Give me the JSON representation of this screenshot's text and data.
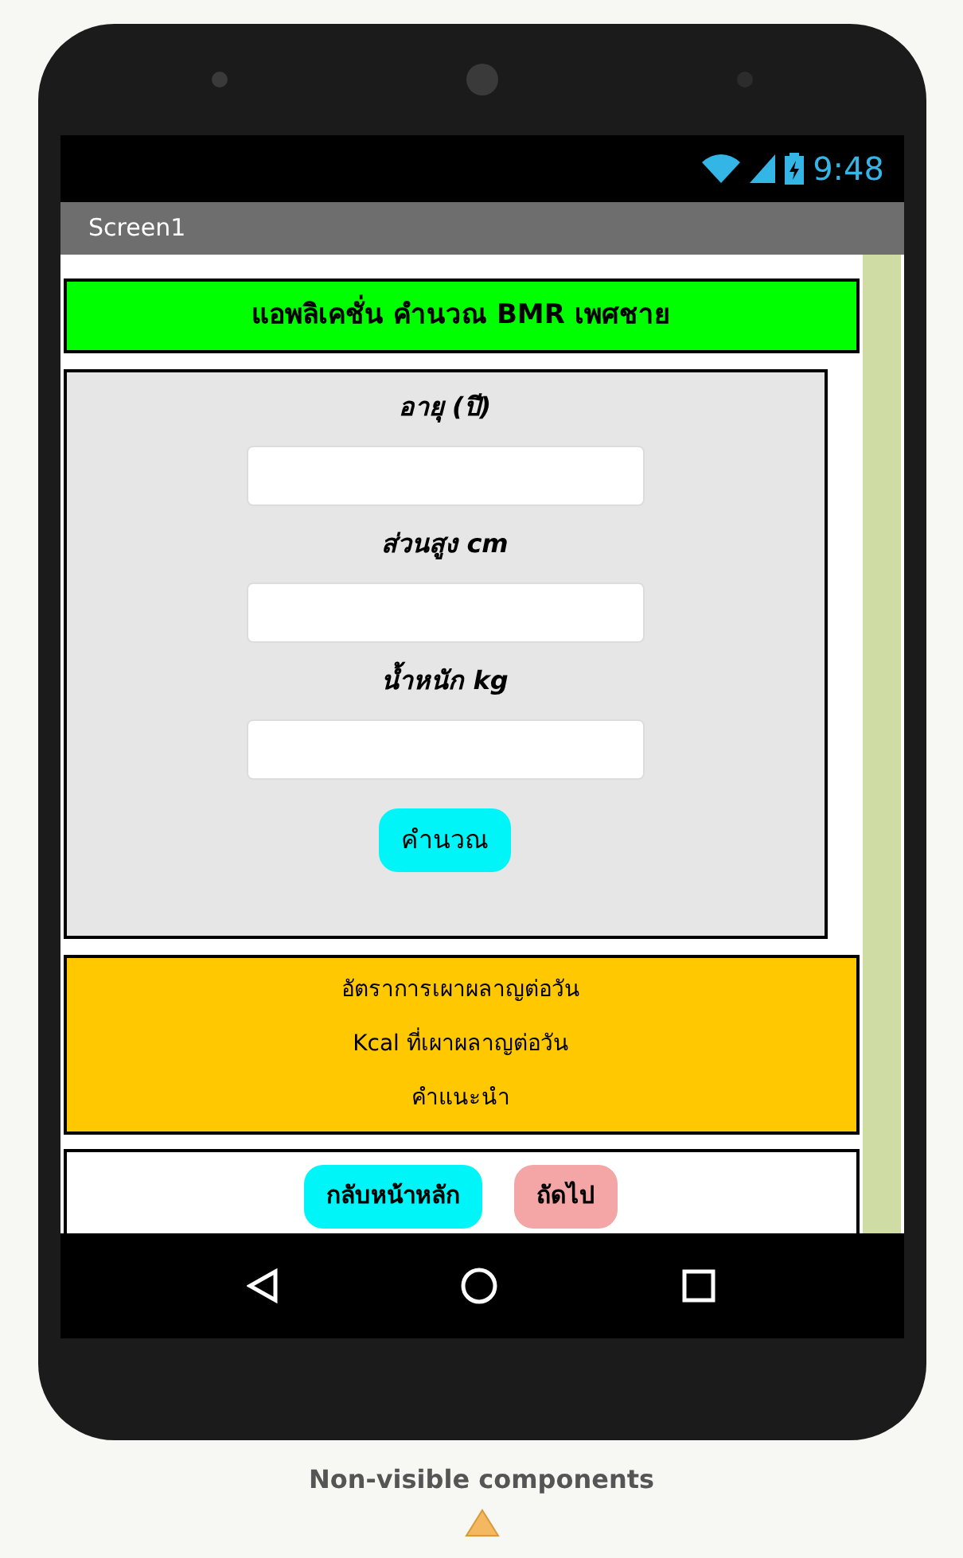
{
  "status_bar": {
    "time": "9:48"
  },
  "title_bar": {
    "title": "Screen1"
  },
  "header": {
    "title": "แอพลิเคชั่น คำนวณ BMR เพศชาย"
  },
  "form": {
    "fields": [
      {
        "label": "อายุ (ปี)"
      },
      {
        "label": "ส่วนสูง cm"
      },
      {
        "label": "น้ำหนัก kg"
      }
    ],
    "button": "คำนวณ"
  },
  "results": [
    "อัตราการเผาผลาญต่อวัน",
    "Kcal ที่เผาผลาญต่อวัน",
    "คำแนะนำ"
  ],
  "footer_buttons": [
    {
      "label": "กลับหน้าหลัก",
      "kind": "home"
    },
    {
      "label": "ถัดไป",
      "kind": "next"
    }
  ],
  "non_visible": {
    "title": "Non-visible components"
  }
}
